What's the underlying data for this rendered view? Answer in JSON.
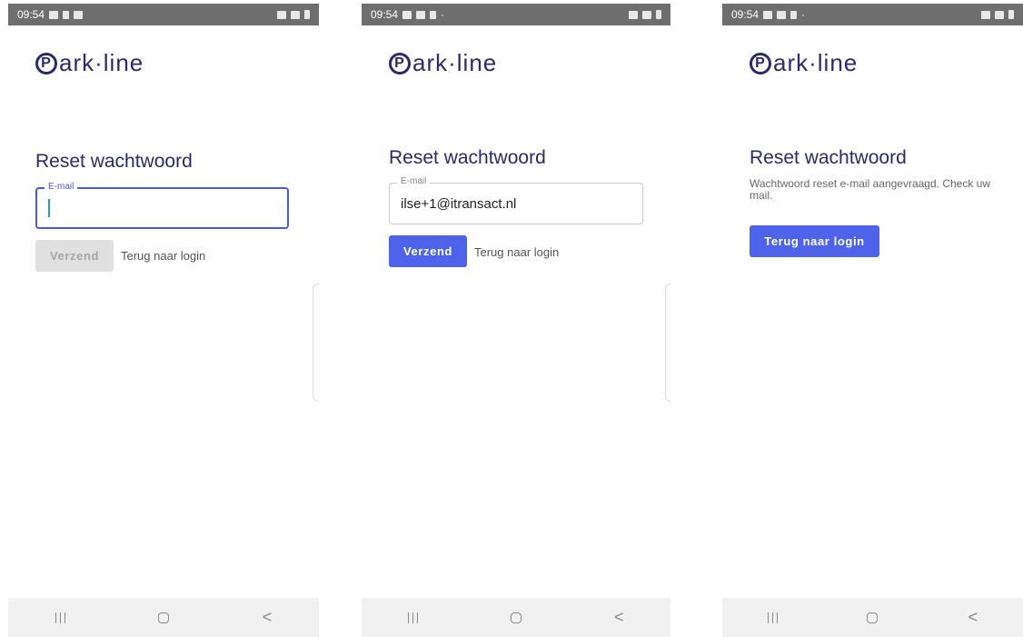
{
  "colors": {
    "brand": "#2c2a6e",
    "accent": "#4c63ea",
    "disabled": "#e0e0e0"
  },
  "icons": {
    "status_left": [
      "image-icon",
      "gallery-icon",
      "hand-icon"
    ],
    "status_right": [
      "mute-icon",
      "signal-icon",
      "battery-icon"
    ],
    "navigation": [
      "recent-apps-icon",
      "home-icon",
      "back-icon"
    ]
  },
  "screens": [
    {
      "status_time": "09:54",
      "brand": "ark·line",
      "title": "Reset wachtwoord",
      "email_label": "E-mail",
      "email_value": "",
      "submit_label": "Verzend",
      "submit_state": "disabled",
      "back_link": "Terug naar login"
    },
    {
      "status_time": "09:54",
      "status_dot": "·",
      "brand": "ark·line",
      "title": "Reset wachtwoord",
      "email_label": "E-mail",
      "email_value": "ilse+1@itransact.nl",
      "submit_label": "Verzend",
      "submit_state": "enabled",
      "back_link": "Terug naar login"
    },
    {
      "status_time": "09:54",
      "status_dot": "·",
      "brand": "ark·line",
      "title": "Reset wachtwoord",
      "message": "Wachtwoord reset e-mail aangevraagd. Check uw mail.",
      "back_button": "Terug naar login"
    }
  ]
}
